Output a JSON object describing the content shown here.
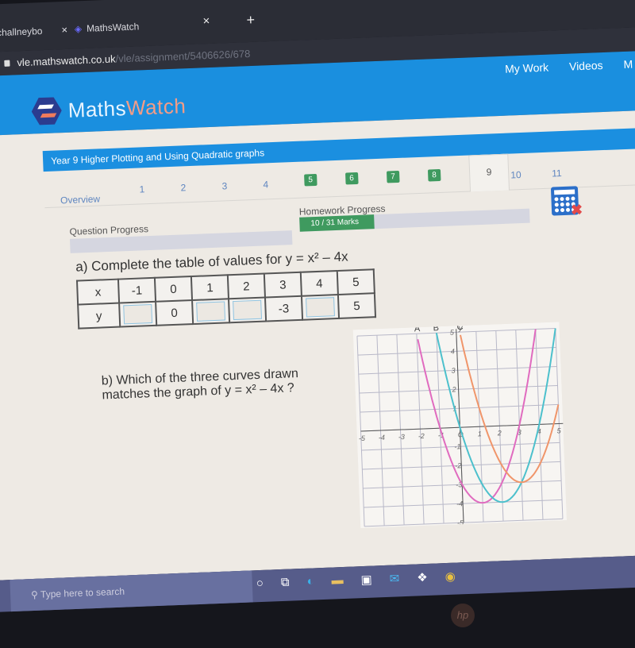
{
  "browser": {
    "tabs": [
      {
        "label": "@challneybo"
      },
      {
        "label": "MathsWatch"
      }
    ],
    "close_glyph": "×",
    "newtab_glyph": "+",
    "url_host": "vle.mathswatch.co.uk",
    "url_path": "/vle/assignment/5406626/678"
  },
  "site": {
    "logo_text_a": "Maths",
    "logo_text_b": "Watch",
    "nav": [
      "My Work",
      "Videos",
      "M"
    ]
  },
  "assignment": {
    "title": "Year 9 Higher Plotting and Using Quadratic graphs",
    "overview_label": "Overview",
    "questions": [
      {
        "label": "1",
        "state": "todo"
      },
      {
        "label": "2",
        "state": "todo"
      },
      {
        "label": "3",
        "state": "todo"
      },
      {
        "label": "4",
        "state": "todo"
      },
      {
        "label": "5",
        "state": "done"
      },
      {
        "label": "6",
        "state": "done"
      },
      {
        "label": "7",
        "state": "done"
      },
      {
        "label": "8",
        "state": "done"
      },
      {
        "label": "9",
        "state": "active"
      },
      {
        "label": "10",
        "state": "todo"
      },
      {
        "label": "11",
        "state": "todo"
      }
    ],
    "question_progress_label": "Question Progress",
    "homework_progress_label": "Homework Progress",
    "homework_marks_text": "10 / 31 Marks",
    "homework_fraction": 0.3226,
    "calculator_icon": "calculator-not-allowed-icon"
  },
  "question": {
    "part_a": "a) Complete the table of values for y = x² – 4x",
    "table": {
      "x_label": "x",
      "y_label": "y",
      "x_values": [
        "-1",
        "0",
        "1",
        "2",
        "3",
        "4",
        "5"
      ],
      "y_values": [
        "",
        "0",
        "",
        "",
        "-3",
        "",
        "5"
      ]
    },
    "part_b_line1": "b) Which of the three curves drawn",
    "part_b_line2": "matches the graph of y = x² – 4x ?"
  },
  "chart_data": {
    "type": "line",
    "xlabel": "x",
    "ylabel": "y",
    "xlim": [
      -5,
      5
    ],
    "ylim": [
      -5,
      5
    ],
    "grid": true,
    "x_ticks": [
      "-5",
      "-4",
      "-3",
      "-2",
      "-1",
      "O",
      "1",
      "2",
      "3",
      "4",
      "5"
    ],
    "y_ticks": [
      "-5",
      "-4",
      "-3",
      "-2",
      "-1",
      "1",
      "2",
      "3",
      "4",
      "5"
    ],
    "series": [
      {
        "name": "A",
        "equation": "y = x² - 2x - 3",
        "color": "#e06bbf",
        "vertex": [
          1,
          -4
        ]
      },
      {
        "name": "B",
        "equation": "y = x² - 4x",
        "color": "#4cc0cc",
        "vertex": [
          2,
          -4
        ]
      },
      {
        "name": "C",
        "equation": "y = x² - 6x + 6",
        "color": "#f0956a",
        "vertex": [
          3,
          -3
        ]
      }
    ]
  },
  "taskbar": {
    "search_placeholder": "Type here to search",
    "icons": [
      "cortana-icon",
      "task-view-icon",
      "edge-icon",
      "file-explorer-icon",
      "store-icon",
      "mail-icon",
      "dropbox-icon",
      "chrome-icon"
    ]
  },
  "device": {
    "brand": "hp"
  }
}
